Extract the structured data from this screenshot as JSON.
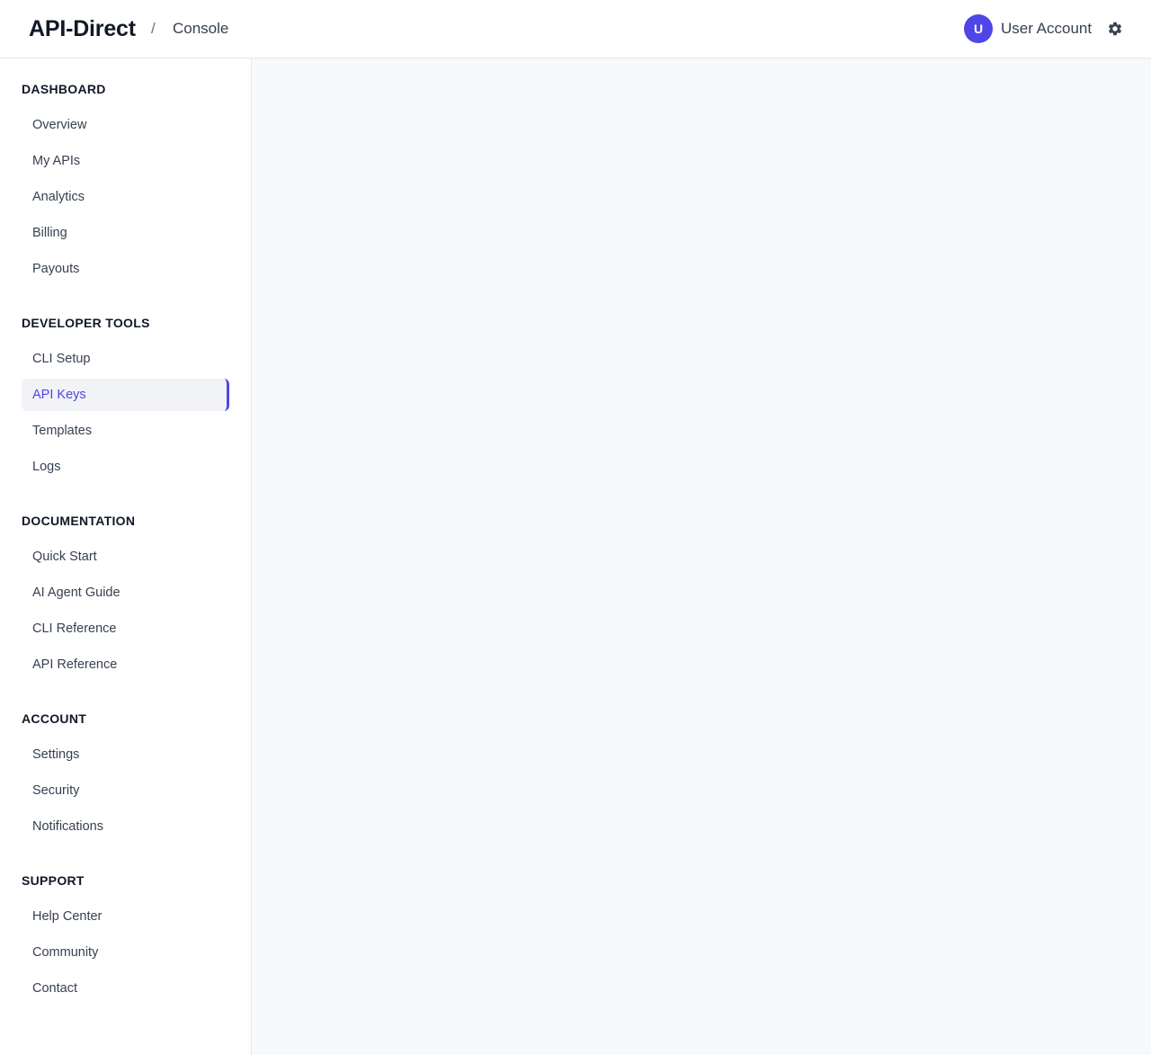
{
  "header": {
    "brand": "API-Direct",
    "separator": "/",
    "page": "Console",
    "account": {
      "avatar_initial": "U",
      "name": "User Account",
      "avatar_color": "#4f46e5"
    },
    "settings_icon": "gear-icon"
  },
  "sidebar": {
    "sections": [
      {
        "title": "DASHBOARD",
        "items": [
          {
            "label": "Overview"
          },
          {
            "label": "My APIs"
          },
          {
            "label": "Analytics"
          },
          {
            "label": "Billing"
          },
          {
            "label": "Payouts"
          }
        ]
      },
      {
        "title": "DEVELOPER TOOLS",
        "items": [
          {
            "label": "CLI Setup"
          },
          {
            "label": "API Keys",
            "active": true
          },
          {
            "label": "Templates"
          },
          {
            "label": "Logs"
          }
        ]
      },
      {
        "title": "DOCUMENTATION",
        "items": [
          {
            "label": "Quick Start"
          },
          {
            "label": "AI Agent Guide"
          },
          {
            "label": "CLI Reference"
          },
          {
            "label": "API Reference"
          }
        ]
      },
      {
        "title": "ACCOUNT",
        "items": [
          {
            "label": "Settings"
          },
          {
            "label": "Security"
          },
          {
            "label": "Notifications"
          }
        ]
      },
      {
        "title": "SUPPORT",
        "items": [
          {
            "label": "Help Center"
          },
          {
            "label": "Community"
          },
          {
            "label": "Contact"
          }
        ]
      }
    ]
  },
  "colors": {
    "accent": "#4f46e5",
    "active_item_bg": "#f1f3f6",
    "main_bg": "#f8f9fb"
  }
}
